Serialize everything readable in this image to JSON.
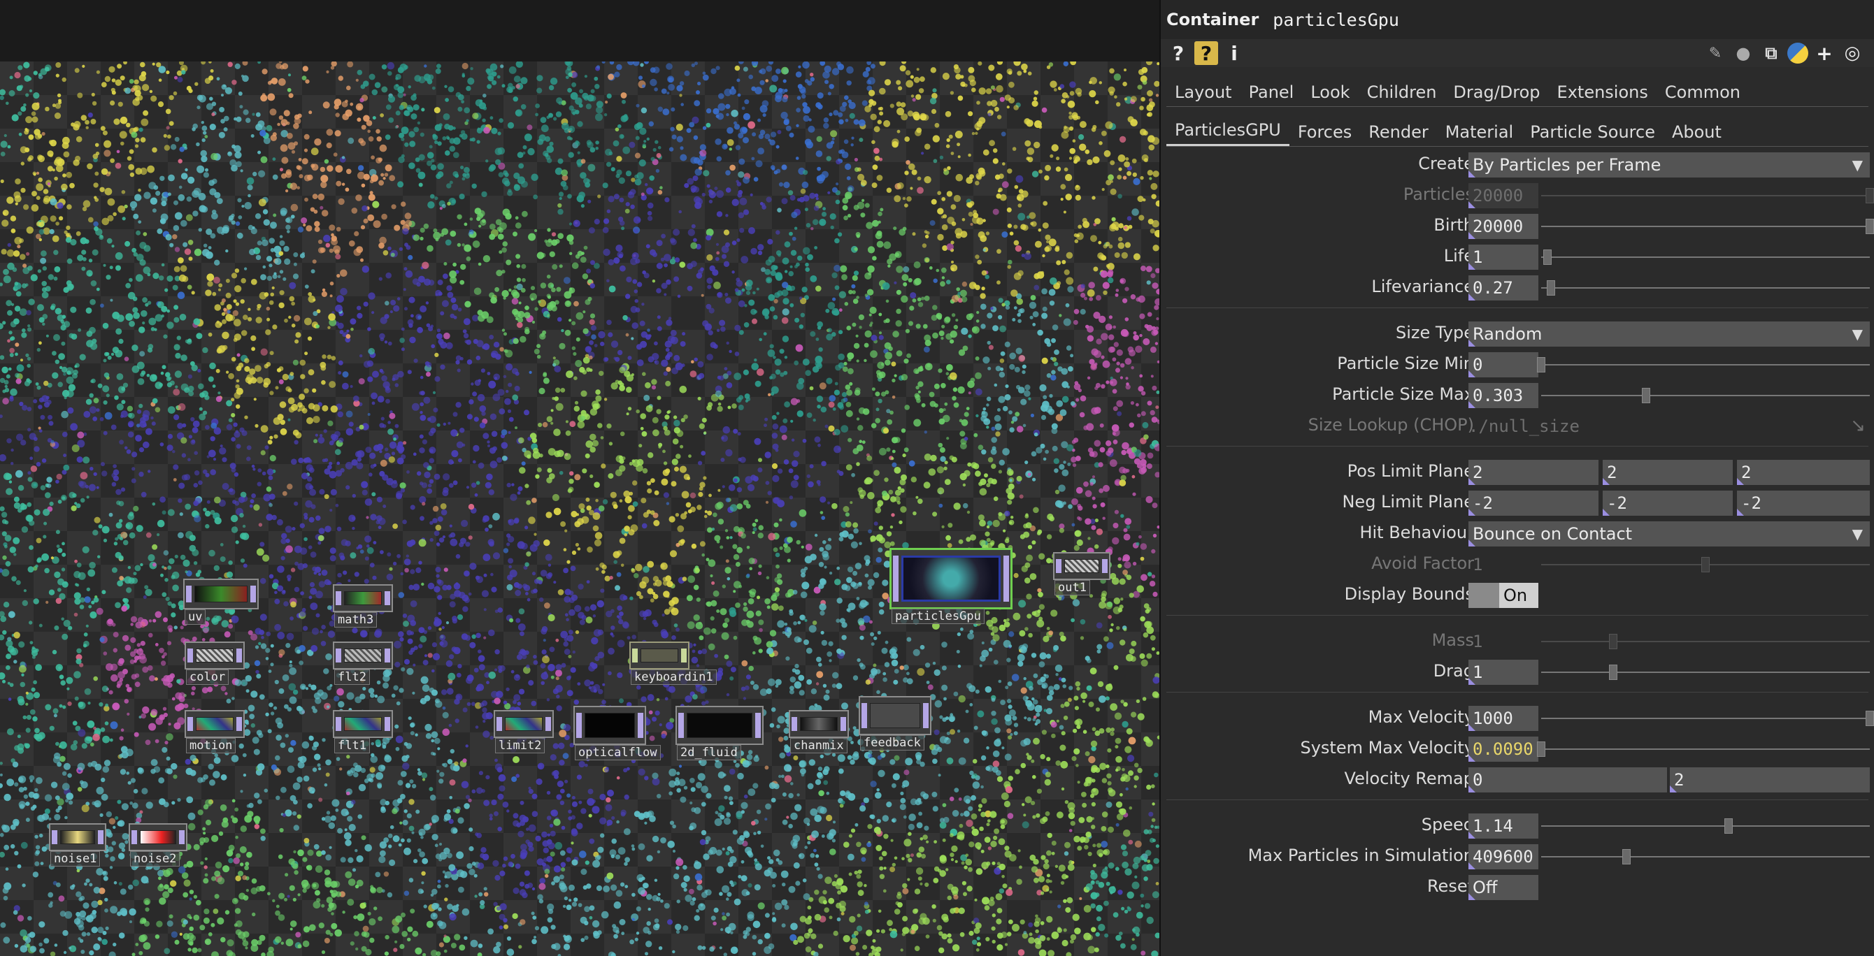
{
  "panel": {
    "op_type": "Container",
    "op_name": "particlesGpu",
    "toolbar_icons": [
      "help-icon",
      "help-operator-icon",
      "info-icon",
      "edit-icon",
      "comment-icon",
      "clone-icon",
      "python-icon",
      "add-icon",
      "viewer-icon"
    ],
    "tabs1": [
      "Layout",
      "Panel",
      "Look",
      "Children",
      "Drag/Drop",
      "Extensions",
      "Common"
    ],
    "tabs2": [
      "ParticlesGPU",
      "Forces",
      "Render",
      "Material",
      "Particle Source",
      "About"
    ],
    "active_tab2": "ParticlesGPU",
    "params": {
      "create": {
        "label": "Create",
        "value": "By Particles per Frame"
      },
      "particles": {
        "label": "Particles",
        "value": "20000",
        "slider": 1.0
      },
      "birth": {
        "label": "Birth",
        "value": "20000",
        "slider": 1.0
      },
      "life": {
        "label": "Life",
        "value": "1",
        "slider": 0.02
      },
      "lifevariance": {
        "label": "Lifevariance",
        "value": "0.27",
        "slider": 0.03
      },
      "size_type": {
        "label": "Size Type",
        "value": "Random"
      },
      "particle_size_min": {
        "label": "Particle Size Min",
        "value": "0",
        "slider": 0.0
      },
      "particle_size_max": {
        "label": "Particle Size Max",
        "value": "0.303",
        "slider": 0.32
      },
      "size_lookup": {
        "label": "Size Lookup (CHOP)",
        "value": "./null_size"
      },
      "pos_limit_plane": {
        "label": "Pos Limit Plane",
        "values": [
          "2",
          "2",
          "2"
        ]
      },
      "neg_limit_plane": {
        "label": "Neg Limit Plane",
        "values": [
          "-2",
          "-2",
          "-2"
        ]
      },
      "hit_behaviour": {
        "label": "Hit Behaviour",
        "value": "Bounce on Contact"
      },
      "avoid_factor": {
        "label": "Avoid Factor",
        "value": "1",
        "slider": 0.5
      },
      "display_bounds": {
        "label": "Display Bounds",
        "value": "On"
      },
      "mass": {
        "label": "Mass",
        "value": "1",
        "slider": 0.22
      },
      "drag": {
        "label": "Drag",
        "value": "1",
        "slider": 0.22
      },
      "max_velocity": {
        "label": "Max Velocity",
        "value": "1000",
        "slider": 1.0
      },
      "system_max_velocity": {
        "label": "System Max Velocity",
        "value": "0.0090",
        "slider": 0.0
      },
      "velocity_remap": {
        "label": "Velocity Remap",
        "values": [
          "0",
          "2"
        ]
      },
      "speed": {
        "label": "Speed",
        "value": "1.14",
        "slider": 0.57
      },
      "max_particles": {
        "label": "Max Particles in Simulation",
        "value": "409600",
        "slider": 0.26
      },
      "reset": {
        "label": "Reset",
        "value": "Off"
      }
    }
  },
  "network": {
    "nodes": [
      {
        "label": "uv"
      },
      {
        "label": "math3"
      },
      {
        "label": "color"
      },
      {
        "label": "flt2"
      },
      {
        "label": "motion"
      },
      {
        "label": "flt1"
      },
      {
        "label": "keyboardin1"
      },
      {
        "label": "limit2"
      },
      {
        "label": "opticalflow"
      },
      {
        "label": "2d_fluid"
      },
      {
        "label": "chanmix"
      },
      {
        "label": "feedback"
      },
      {
        "label": "particlesGpu"
      },
      {
        "label": "out1"
      },
      {
        "label": "noise1"
      },
      {
        "label": "noise2"
      }
    ]
  }
}
